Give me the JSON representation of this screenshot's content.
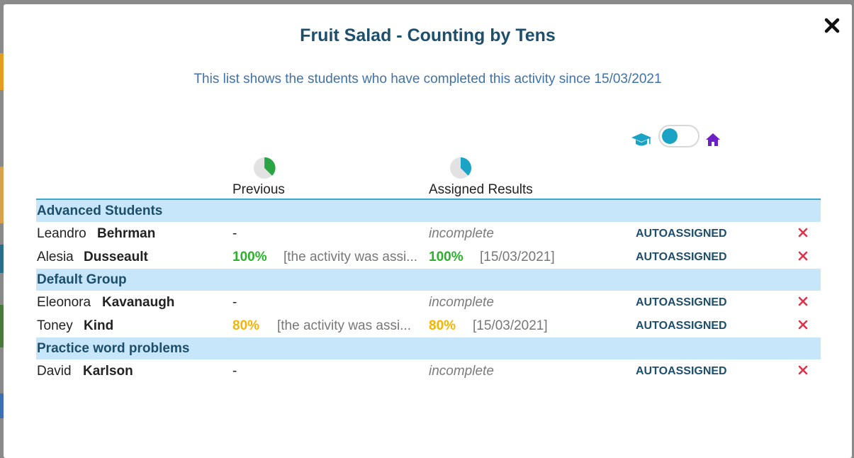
{
  "modal": {
    "title": "Fruit Salad - Counting by Tens",
    "subtitle": "This list shows the students who have completed this activity since 15/03/2021",
    "close_icon": "close-icon"
  },
  "toggle": {
    "left_icon": "graduation-cap-icon",
    "right_icon": "home-icon",
    "state": "left"
  },
  "columns": {
    "previous": "Previous",
    "assigned": "Assigned Results"
  },
  "colors": {
    "title": "#1d4e6b",
    "subtitle": "#3f72a9",
    "group_bg": "#c8e6f9",
    "green": "#2bb12b",
    "yellow": "#f4b400",
    "delete": "#e0314b",
    "toggle": "#1aa3c4",
    "home": "#6a1fc9"
  },
  "groups": [
    {
      "name": "Advanced Students",
      "students": [
        {
          "first": "Leandro",
          "last": "Behrman",
          "prev_score": "-",
          "prev_note": "",
          "assigned": "incomplete",
          "assigned_date": "",
          "status": "AUTOASSIGNED"
        },
        {
          "first": "Alesia",
          "last": "Dusseault",
          "prev_score": "100%",
          "prev_note": "[the activity was assi...",
          "assigned": "100%",
          "assigned_date": "[15/03/2021]",
          "status": "AUTOASSIGNED"
        }
      ]
    },
    {
      "name": "Default Group",
      "students": [
        {
          "first": "Eleonora",
          "last": "Kavanaugh",
          "prev_score": "-",
          "prev_note": "",
          "assigned": "incomplete",
          "assigned_date": "",
          "status": "AUTOASSIGNED"
        },
        {
          "first": "Toney",
          "last": "Kind",
          "prev_score": "80%",
          "prev_note": "[the activity was assi...",
          "assigned": "80%",
          "assigned_date": "[15/03/2021]",
          "status": "AUTOASSIGNED"
        }
      ]
    },
    {
      "name": "Practice word problems",
      "students": [
        {
          "first": "David",
          "last": "Karlson",
          "prev_score": "-",
          "prev_note": "",
          "assigned": "incomplete",
          "assigned_date": "",
          "status": "AUTOASSIGNED"
        }
      ]
    }
  ]
}
